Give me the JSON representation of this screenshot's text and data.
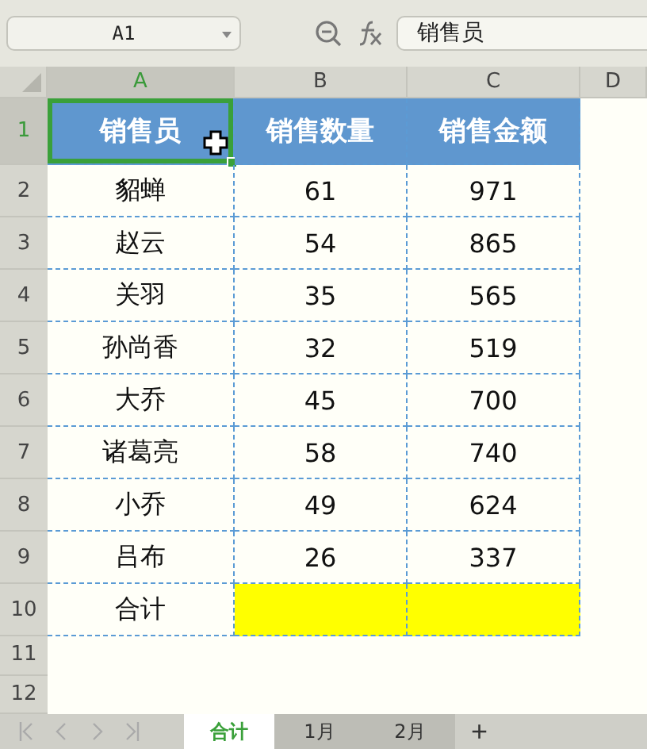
{
  "toolbar": {
    "name_box": "A1",
    "formula": "销售员"
  },
  "columns": [
    {
      "label": "A",
      "selected": true
    },
    {
      "label": "B",
      "selected": false
    },
    {
      "label": "C",
      "selected": false
    },
    {
      "label": "D",
      "selected": false
    }
  ],
  "rows": [
    {
      "number": "1",
      "kind": "header",
      "selected": true,
      "cells": [
        {
          "text": "销售员",
          "selected": true
        },
        {
          "text": "销售数量",
          "selected": false
        },
        {
          "text": "销售金额",
          "selected": false
        }
      ]
    },
    {
      "number": "2",
      "kind": "data",
      "selected": false,
      "cells": [
        {
          "text": "貂蝉"
        },
        {
          "text": "61"
        },
        {
          "text": "971"
        }
      ]
    },
    {
      "number": "3",
      "kind": "data",
      "selected": false,
      "cells": [
        {
          "text": "赵云"
        },
        {
          "text": "54"
        },
        {
          "text": "865"
        }
      ]
    },
    {
      "number": "4",
      "kind": "data",
      "selected": false,
      "cells": [
        {
          "text": "关羽"
        },
        {
          "text": "35"
        },
        {
          "text": "565"
        }
      ]
    },
    {
      "number": "5",
      "kind": "data",
      "selected": false,
      "cells": [
        {
          "text": "孙尚香"
        },
        {
          "text": "32"
        },
        {
          "text": "519"
        }
      ]
    },
    {
      "number": "6",
      "kind": "data",
      "selected": false,
      "cells": [
        {
          "text": "大乔"
        },
        {
          "text": "45"
        },
        {
          "text": "700"
        }
      ]
    },
    {
      "number": "7",
      "kind": "data",
      "selected": false,
      "cells": [
        {
          "text": "诸葛亮"
        },
        {
          "text": "58"
        },
        {
          "text": "740"
        }
      ]
    },
    {
      "number": "8",
      "kind": "data",
      "selected": false,
      "cells": [
        {
          "text": "小乔"
        },
        {
          "text": "49"
        },
        {
          "text": "624"
        }
      ]
    },
    {
      "number": "9",
      "kind": "data",
      "selected": false,
      "cells": [
        {
          "text": "吕布"
        },
        {
          "text": "26"
        },
        {
          "text": "337"
        }
      ]
    },
    {
      "number": "10",
      "kind": "data",
      "selected": false,
      "cells": [
        {
          "text": "合计",
          "highlighted": false
        },
        {
          "highlighted": true
        },
        {
          "highlighted": true
        }
      ]
    },
    {
      "number": "11",
      "kind": "empty",
      "selected": false,
      "cells": []
    },
    {
      "number": "12",
      "kind": "empty",
      "selected": false,
      "cells": []
    }
  ],
  "sheet_tabs": [
    {
      "label": "合计",
      "selected": true
    },
    {
      "label": "1月",
      "selected": false
    },
    {
      "label": "2月",
      "selected": false
    }
  ],
  "add_sheet": "+"
}
